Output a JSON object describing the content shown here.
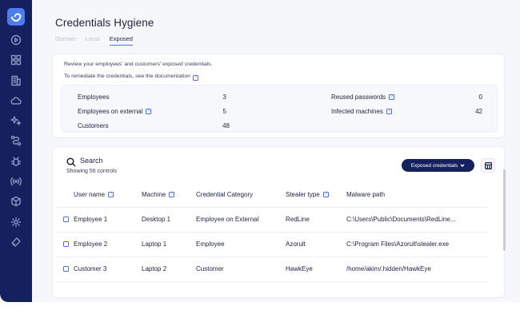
{
  "page": {
    "title": "Credentials Hygiene",
    "tabs": [
      {
        "label": "Domain",
        "active": false
      },
      {
        "label": "Local",
        "active": false
      },
      {
        "label": "Exposed",
        "active": true
      }
    ]
  },
  "info": {
    "line1": "Review your employees' and customers' exposed credentials.",
    "line2": "To remediate the credentials, see the documentation",
    "help_glyph": "?"
  },
  "stats": {
    "left": [
      {
        "label": "Employees",
        "value": "3",
        "help": false
      },
      {
        "label": "Employees on external",
        "value": "5",
        "help": true
      },
      {
        "label": "Customers",
        "value": "48",
        "help": false
      }
    ],
    "right": [
      {
        "label": "Reused passwords",
        "value": "0",
        "help": true
      },
      {
        "label": "Infected machines",
        "value": "42",
        "help": true
      }
    ]
  },
  "table_panel": {
    "search_label": "Search",
    "showing": "Showing 56 controls",
    "dropdown_label": "Exposed credentials",
    "columns": [
      {
        "label": "User name",
        "help": true
      },
      {
        "label": "Machine",
        "help": true
      },
      {
        "label": "Credential Category",
        "help": false
      },
      {
        "label": "Stealer type",
        "help": true
      },
      {
        "label": "Malware path",
        "help": false
      }
    ],
    "rows": [
      {
        "user": "Employee 1",
        "machine": "Desktop 1",
        "category": "Employee on External",
        "stealer": "RedLine",
        "path": "C:\\Users\\Public\\Documents\\RedLine..."
      },
      {
        "user": "Employee 2",
        "machine": "Laptop 1",
        "category": "Employee",
        "stealer": "Azorult",
        "path": "C:\\Program Files\\Azorult\\stealer.exe"
      },
      {
        "user": "Customer 3",
        "machine": "Laptop 2",
        "category": "Customer",
        "stealer": "HawkEye",
        "path": "/home/akim/.hidden/HawkEye"
      }
    ]
  },
  "colors": {
    "sidebar": "#14215e",
    "accent": "#4b6ee8",
    "background": "#f6f7fa"
  },
  "sidebar_icons": [
    "play-icon",
    "grid-icon",
    "building-icon",
    "cloud-icon",
    "sparkle-icon",
    "workflow-icon",
    "bug-icon",
    "broadcast-icon",
    "cube-icon",
    "gear-icon",
    "tag-icon"
  ]
}
